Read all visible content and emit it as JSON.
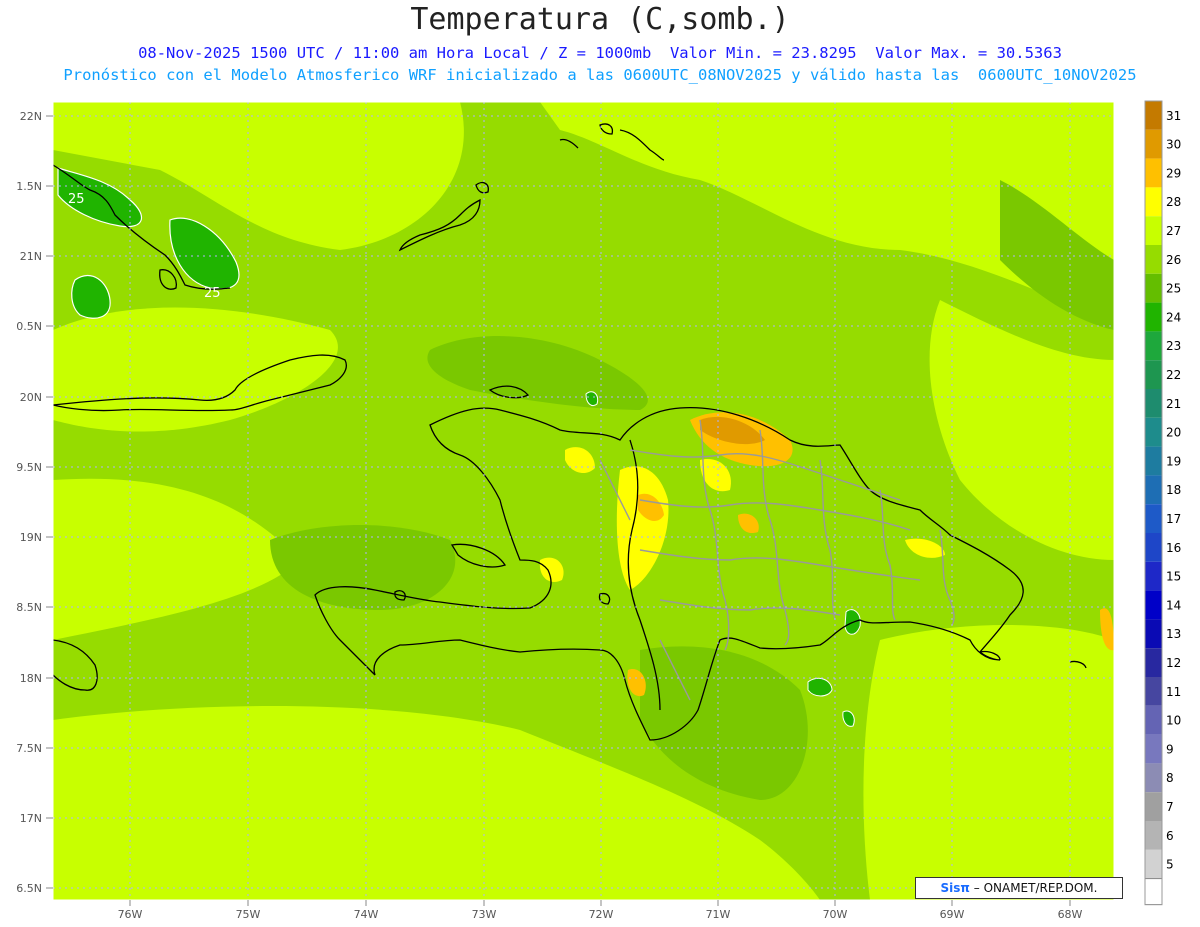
{
  "title": "Temperatura (C,somb.)",
  "subtitle_line1": "08-Nov-2025 1500 UTC / 11:00 am Hora Local / Z = 1000mb  Valor Min. = 23.8295  Valor Max. = 30.5363",
  "subtitle_line2": "Pronóstico con el Modelo Atmosferico WRF inicializado a las 0600UTC_08NOV2025 y válido hasta las  0600UTC_10NOV2025",
  "map": {
    "lat_labels": [
      "22N",
      "1.5N",
      "21N",
      "0.5N",
      "20N",
      "9.5N",
      "19N",
      "8.5N",
      "18N",
      "7.5N",
      "17N",
      "6.5N"
    ],
    "lon_labels": [
      "76W",
      "75W",
      "74W",
      "73W",
      "72W",
      "71W",
      "70W",
      "69W",
      "68W"
    ],
    "contour_labels": [
      "25",
      "25"
    ]
  },
  "colorbar": {
    "levels": [
      "31",
      "30",
      "29",
      "28",
      "27",
      "26",
      "25",
      "24",
      "23",
      "22",
      "21",
      "20",
      "19",
      "18",
      "17",
      "16",
      "15",
      "14",
      "13",
      "12",
      "11",
      "10",
      "9",
      "8",
      "7",
      "6",
      "5"
    ],
    "colors": [
      "#c47a00",
      "#e09a00",
      "#ffc000",
      "#ffff00",
      "#c8ff00",
      "#96dc00",
      "#64be00",
      "#20b400",
      "#1ea83c",
      "#1e9650",
      "#1e8c6e",
      "#1e8c8c",
      "#1e7ca0",
      "#1e6eb4",
      "#1e5ac8",
      "#1e46c8",
      "#1e28c8",
      "#0000c8",
      "#0a0ab4",
      "#2828a0",
      "#4646a0",
      "#6464b4",
      "#7878be",
      "#8c8cb4",
      "#a0a0a0",
      "#b4b4b4",
      "#d2d2d2"
    ]
  },
  "credit": {
    "logo": "Sisπ",
    "text": "– ONAMET/REP.DOM."
  }
}
